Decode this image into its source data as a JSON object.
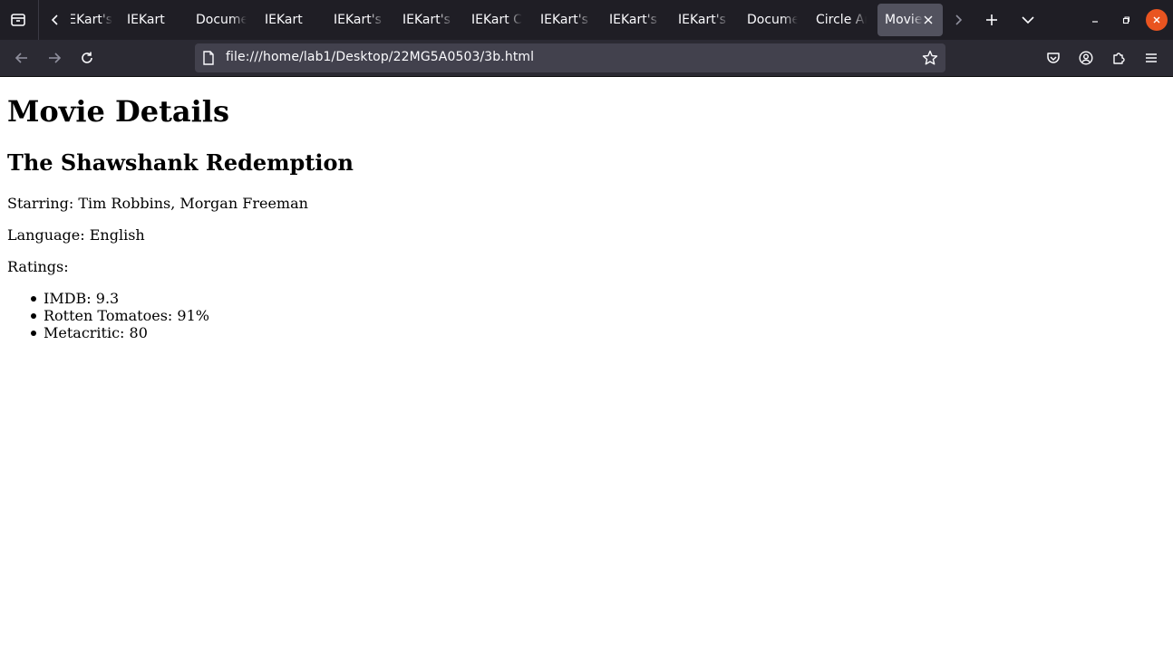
{
  "browser": {
    "tabs": [
      {
        "label": "IEKart's"
      },
      {
        "label": "IEKart"
      },
      {
        "label": "Document"
      },
      {
        "label": "IEKart"
      },
      {
        "label": "IEKart's"
      },
      {
        "label": "IEKart's"
      },
      {
        "label": "IEKart C"
      },
      {
        "label": "IEKart's"
      },
      {
        "label": "IEKart's"
      },
      {
        "label": "IEKart's"
      },
      {
        "label": "Document"
      },
      {
        "label": "Circle Ar"
      },
      {
        "label": "Movie",
        "active": true
      }
    ],
    "address": "file:///home/lab1/Desktop/22MG5A0503/3b.html",
    "icons": {
      "list_all_tabs": "tab-list-icon",
      "scroll_left": "chevron-left-icon",
      "scroll_right": "chevron-right-icon",
      "new_tab": "plus-icon",
      "tab_overflow": "chevron-down-icon",
      "back": "arrow-left-icon",
      "forward": "arrow-right-icon",
      "reload": "reload-icon",
      "page": "file-icon",
      "bookmark": "star-icon",
      "pocket": "pocket-icon",
      "account": "account-icon",
      "extensions": "puzzle-icon",
      "menu": "hamburger-menu-icon"
    },
    "colors": {
      "tabbar": "#1f1e25",
      "navbar": "#2b2a33",
      "urlbar": "#42414d",
      "active_tab": "#52525e",
      "close_window": "#e95420"
    }
  },
  "page": {
    "heading": "Movie Details",
    "movie_title": "The Shawshank Redemption",
    "starring": "Starring: Tim Robbins, Morgan Freeman",
    "language": "Language: English",
    "ratings_label": "Ratings:",
    "ratings": [
      "IMDB: 9.3",
      "Rotten Tomatoes: 91%",
      "Metacritic: 80"
    ]
  }
}
